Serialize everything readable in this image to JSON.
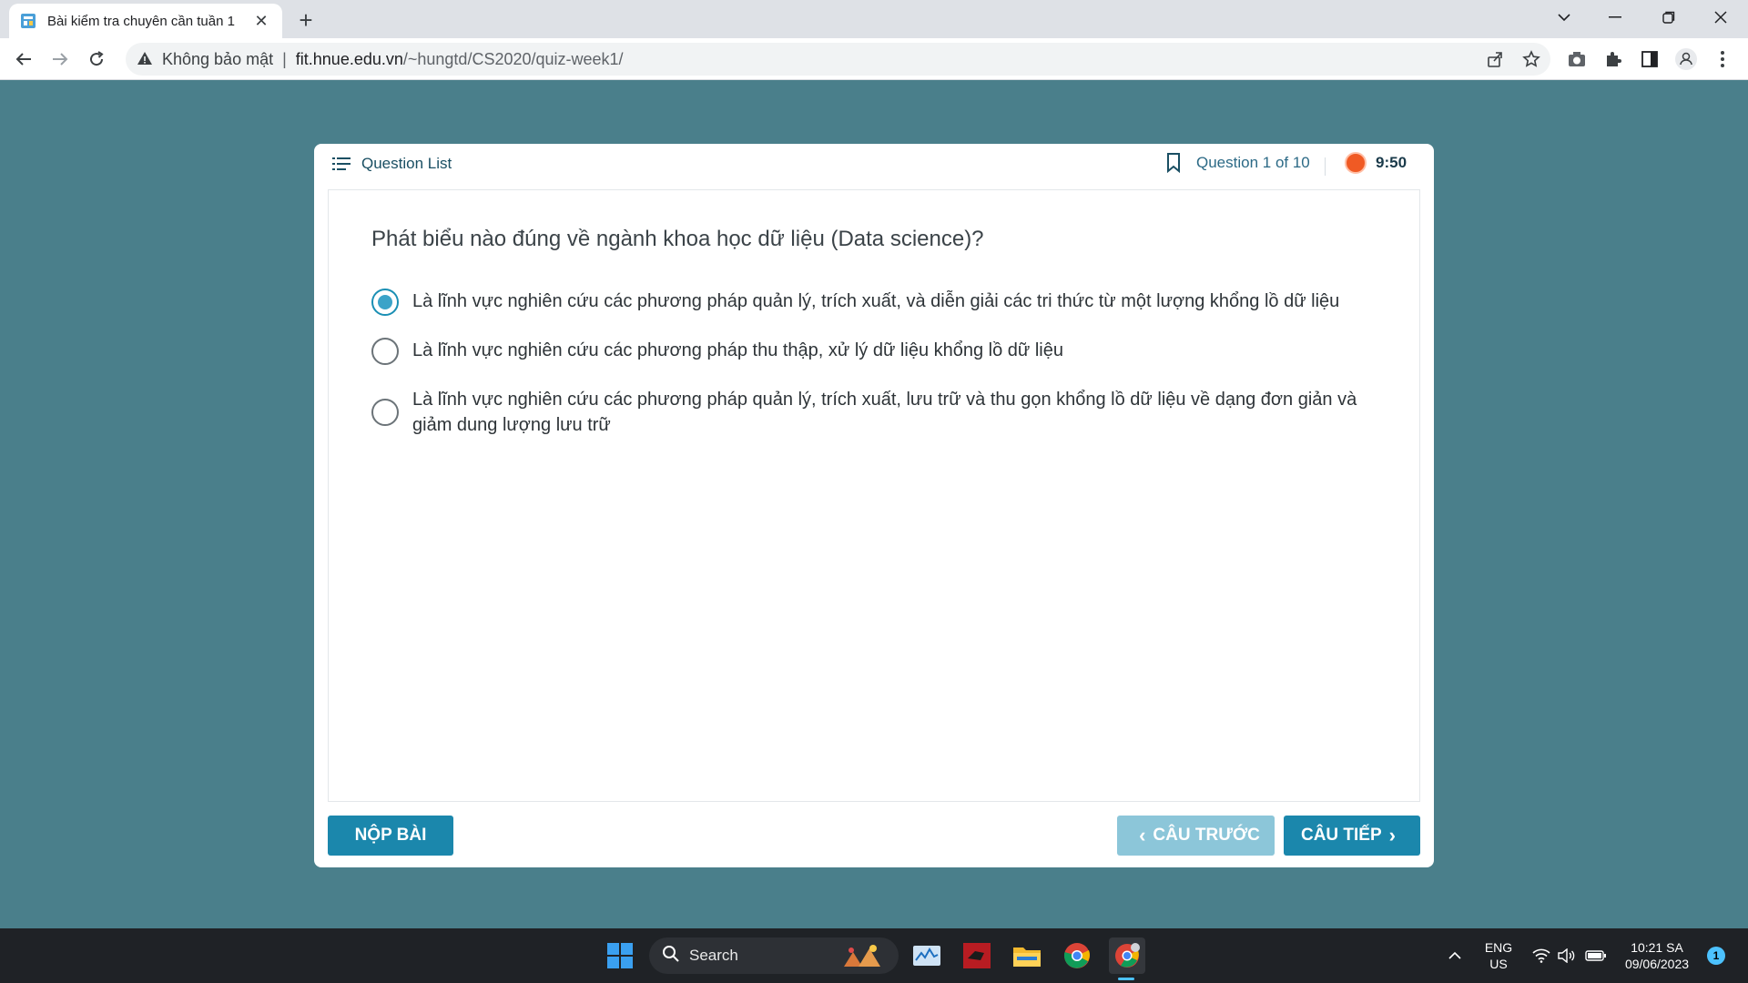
{
  "browser": {
    "tab_title": "Bài kiểm tra chuyên cần tuần 1",
    "security_label": "Không bảo mật",
    "url_host": "fit.hnue.edu.vn",
    "url_path": "/~hungtd/CS2020/quiz-week1/"
  },
  "quiz": {
    "question_list_label": "Question List",
    "question_counter": "Question 1 of 10",
    "timer": "9:50",
    "question": "Phát biểu nào đúng về ngành khoa học dữ liệu (Data science)?",
    "options": [
      {
        "text": "Là lĩnh vực nghiên cứu các phương pháp quản lý, trích xuất, và diễn giải các tri thức từ một lượng khổng lồ dữ liệu",
        "selected": true
      },
      {
        "text": "Là lĩnh vực nghiên cứu các phương pháp thu thập, xử lý dữ liệu khổng lồ dữ liệu",
        "selected": false
      },
      {
        "text": "Là lĩnh vực nghiên cứu các phương pháp quản lý, trích xuất, lưu trữ và thu gọn khổng lồ dữ liệu về dạng đơn giản và giảm dung lượng lưu trữ",
        "selected": false
      }
    ],
    "submit_label": "NỘP BÀI",
    "prev_label": "CÂU TRƯỚC",
    "next_label": "CÂU TIẾP"
  },
  "taskbar": {
    "search_label": "Search",
    "lang_top": "ENG",
    "lang_bottom": "US",
    "time": "10:21 SA",
    "date": "09/06/2023",
    "notification_count": "1"
  },
  "colors": {
    "page_background": "#4a7f8b",
    "primary_button": "#1b87ac",
    "disabled_button": "#8cc6d9",
    "timer_dot": "#f05a24"
  }
}
